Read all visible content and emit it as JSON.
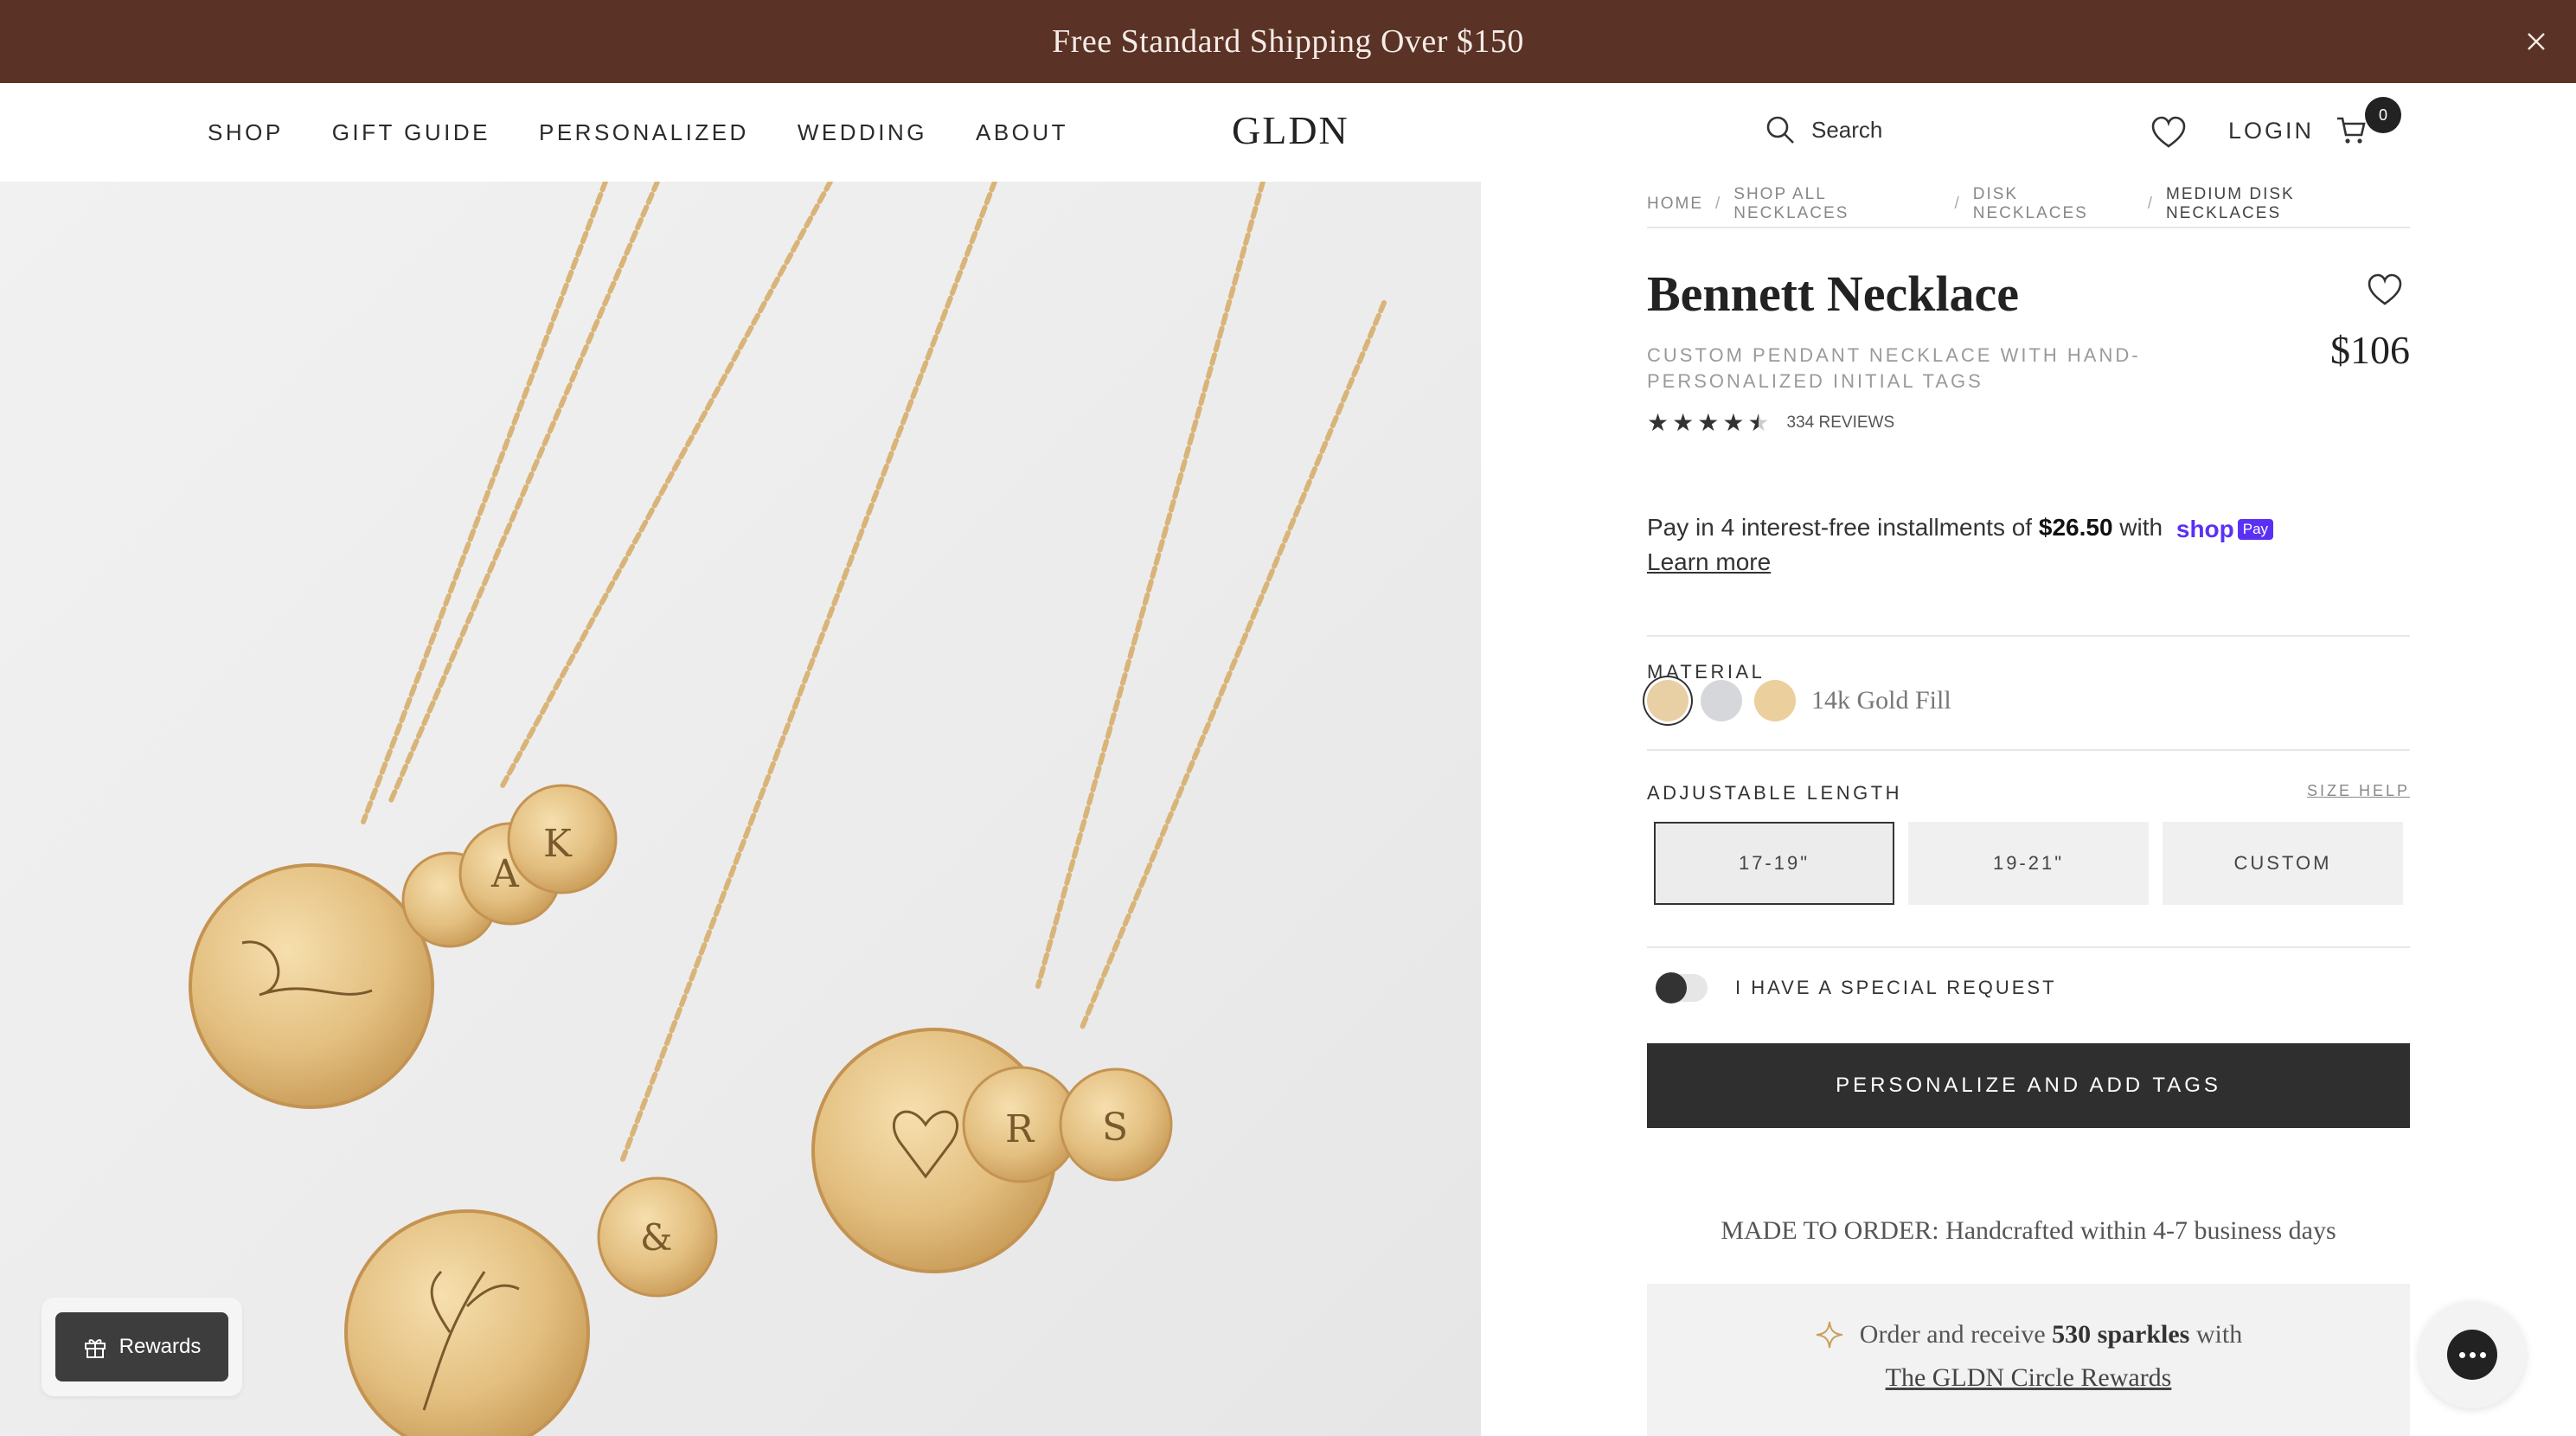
{
  "announcement": {
    "text": "Free Standard Shipping Over $150",
    "background": "#5a3226"
  },
  "header": {
    "nav": [
      "SHOP",
      "GIFT GUIDE",
      "PERSONALIZED",
      "WEDDING",
      "ABOUT"
    ],
    "logo": "GLDN",
    "search_label": "Search",
    "login_label": "LOGIN",
    "cart_count": "0"
  },
  "breadcrumb": [
    "HOME",
    "SHOP ALL NECKLACES",
    "DISK NECKLACES",
    "MEDIUM DISK NECKLACES"
  ],
  "product": {
    "title": "Bennett Necklace",
    "subtitle": "CUSTOM PENDANT NECKLACE WITH HAND-PERSONALIZED INITIAL TAGS",
    "price": "$106",
    "rating": 4.5,
    "reviews": "334 REVIEWS"
  },
  "installments": {
    "prefix": "Pay in 4 interest-free installments of",
    "amount": "$26.50",
    "with": "with",
    "shoppay_word": "shop",
    "shoppay_badge": "Pay",
    "learn_more": "Learn more"
  },
  "material": {
    "label": "MATERIAL",
    "options": [
      {
        "color": "#e8cfa4"
      },
      {
        "color": "#d5d7da"
      },
      {
        "color": "#ebcf9d"
      }
    ],
    "selected_index": 0,
    "selected_label": "14k Gold Fill"
  },
  "length": {
    "label": "ADJUSTABLE LENGTH",
    "size_help": "SIZE HELP",
    "options": [
      "17-19\"",
      "19-21\"",
      "CUSTOM"
    ],
    "selected_index": 0
  },
  "special_request": {
    "label": "I HAVE A SPECIAL REQUEST",
    "enabled": false
  },
  "cta": {
    "label": "PERSONALIZE AND ADD TAGS"
  },
  "made_to_order": "MADE TO ORDER: Handcrafted within 4-7 business days",
  "sparkles": {
    "prefix": "Order and receive",
    "amount": "530 sparkles",
    "suffix": "with",
    "link": "The GLDN Circle Rewards"
  },
  "rewards_button": {
    "label": "Rewards"
  },
  "hero_image": {
    "alt": "Gold disk necklaces"
  }
}
